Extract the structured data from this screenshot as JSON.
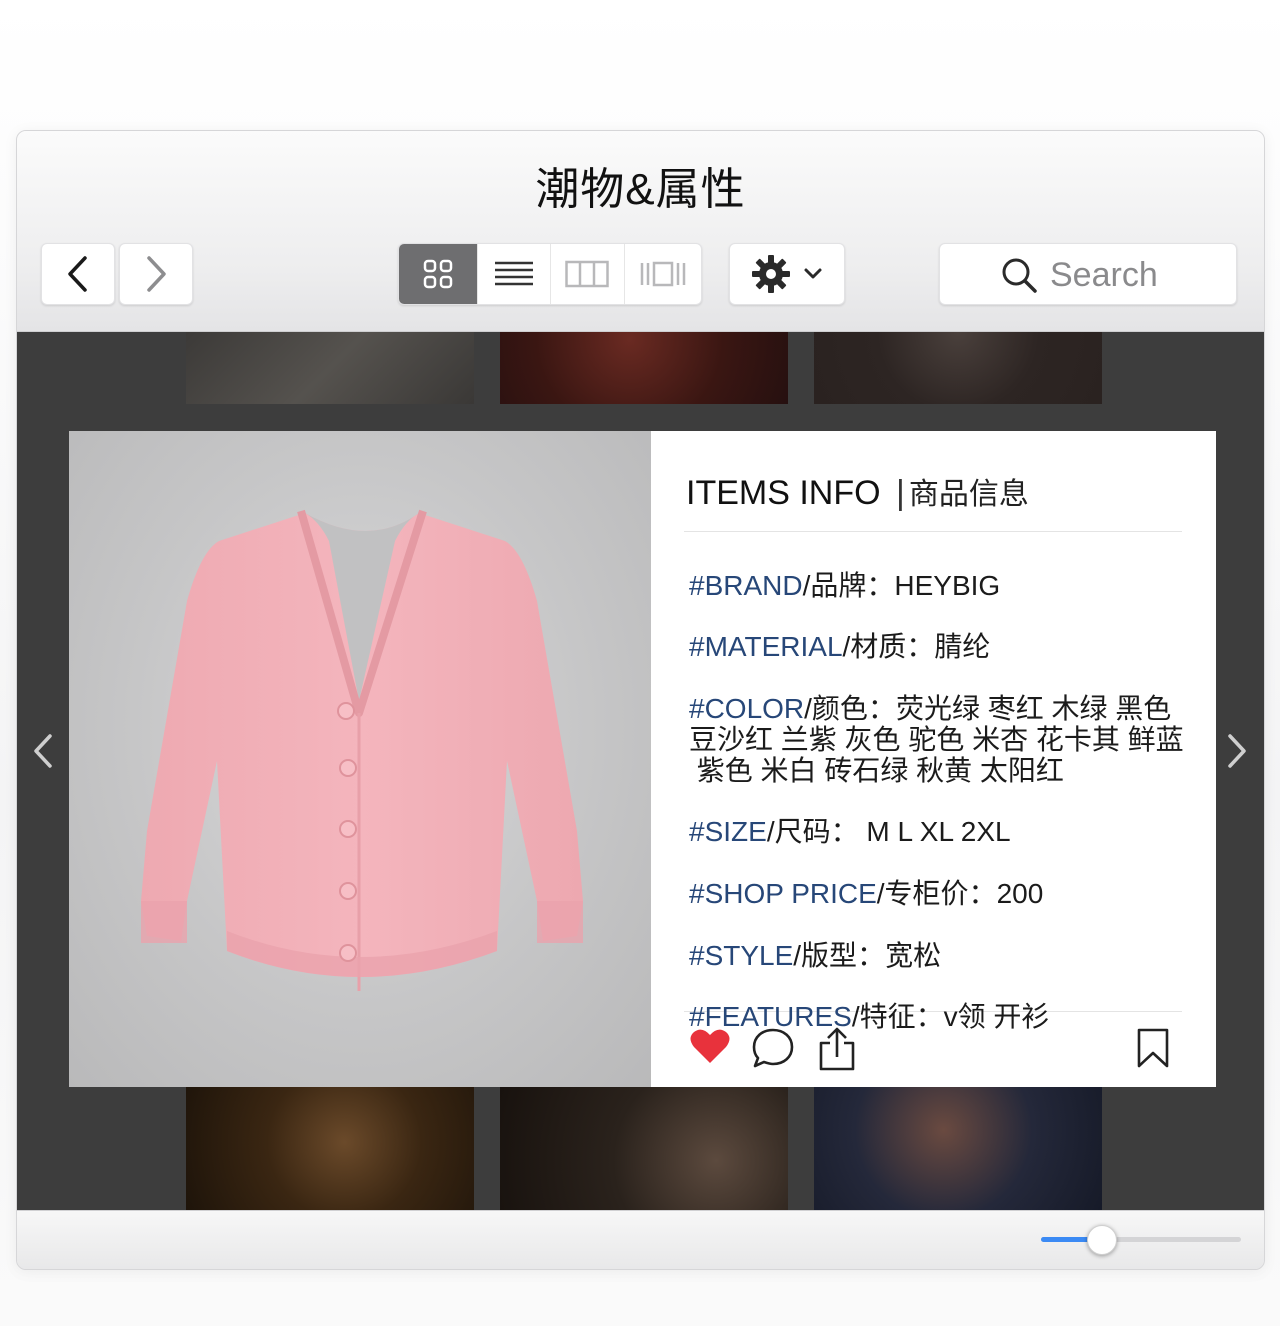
{
  "window": {
    "title": "潮物&属性"
  },
  "toolbar": {
    "back_icon": "chevron-left-icon",
    "forward_icon": "chevron-right-icon",
    "view_modes": [
      {
        "icon": "grid-view-icon",
        "active": true
      },
      {
        "icon": "list-view-icon",
        "active": false
      },
      {
        "icon": "column-view-icon",
        "active": false
      },
      {
        "icon": "coverflow-view-icon",
        "active": false
      }
    ],
    "action_icon": "gear-icon",
    "search": {
      "placeholder": "Search",
      "icon": "search-icon"
    }
  },
  "item": {
    "header_en": "ITEMS INFO",
    "header_zh": "商品信息",
    "photo": "pink-cardigan",
    "rows": [
      {
        "tag": "#BRAND",
        "label": "/品牌：",
        "value": "HEYBIG"
      },
      {
        "tag": "#MATERIAL",
        "label": "/材质：",
        "value": "腈纶"
      },
      {
        "tag": "#COLOR",
        "label": "/颜色：",
        "value": "荧光绿 枣红 木绿 黑色",
        "line2": "豆沙红 兰紫 灰色 驼色 米杏 花卡其 鲜蓝",
        "line3": " 紫色 米白 砖石绿 秋黄 太阳红"
      },
      {
        "tag": "#SIZE",
        "label": "/尺码：",
        "value": " M L XL 2XL"
      },
      {
        "tag": "#SHOP PRICE",
        "label": "/专柜价：",
        "value": "200"
      },
      {
        "tag": "#STYLE",
        "label": "/版型：",
        "value": "宽松"
      },
      {
        "tag": "#FEATURES",
        "label": "/特征：",
        "value": "v领 开衫"
      }
    ],
    "actions": [
      "heart-icon",
      "comment-icon",
      "share-icon",
      "bookmark-icon"
    ],
    "liked": true
  },
  "zoom": {
    "level": 0.3
  },
  "colors": {
    "accent": "#3b8af4",
    "heart": "#e8323c",
    "tag": "#274778",
    "card_bg": "#ffffff",
    "gallery_bg": "#3d3d3d"
  }
}
